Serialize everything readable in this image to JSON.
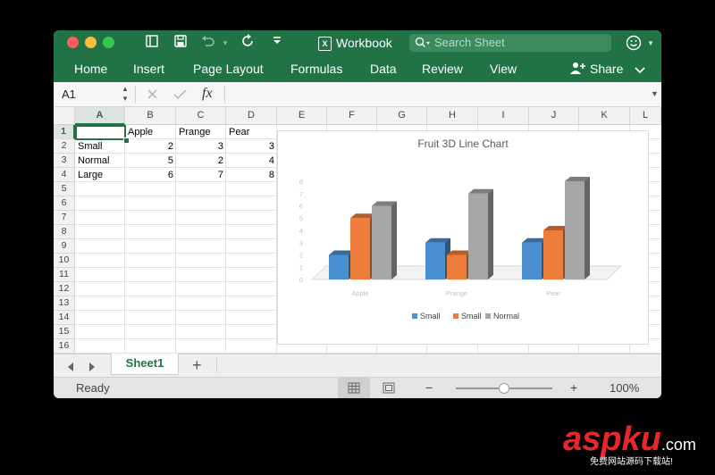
{
  "window": {
    "title": "Workbook"
  },
  "search": {
    "placeholder": "Search Sheet"
  },
  "ribbon": {
    "tabs": [
      "Home",
      "Insert",
      "Page Layout",
      "Formulas",
      "Data",
      "Review",
      "View"
    ],
    "share_label": "Share"
  },
  "formula_bar": {
    "name_box": "A1",
    "fx_label": "fx",
    "formula": ""
  },
  "grid": {
    "columns": [
      "A",
      "B",
      "C",
      "D",
      "E",
      "F",
      "G",
      "H",
      "I",
      "J",
      "K",
      "L"
    ],
    "rows": [
      "1",
      "2",
      "3",
      "4",
      "5",
      "6",
      "7",
      "8",
      "9",
      "10",
      "11",
      "12",
      "13",
      "14",
      "15",
      "16"
    ],
    "cells": {
      "B1": "Apple",
      "C1": "Prange",
      "D1": "Pear",
      "A2": "Small",
      "B2": "2",
      "C2": "3",
      "D2": "3",
      "A3": "Normal",
      "B3": "5",
      "C3": "2",
      "D3": "4",
      "A4": "Large",
      "B4": "6",
      "C4": "7",
      "D4": "8"
    },
    "selected_cell": "A1"
  },
  "chart_data": {
    "type": "bar",
    "title": "Fruit 3D Line Chart",
    "categories": [
      "Apple",
      "Prange",
      "Pear"
    ],
    "series": [
      {
        "name": "Small",
        "values": [
          2,
          3,
          3
        ],
        "color": "#4a8fd0"
      },
      {
        "name": "Small",
        "values": [
          5,
          2,
          4
        ],
        "color": "#ee7d3b"
      },
      {
        "name": "Normal",
        "values": [
          6,
          7,
          8
        ],
        "color": "#a6a6a6"
      }
    ],
    "yticks": [
      "0",
      "1",
      "2",
      "3",
      "4",
      "5",
      "6",
      "7",
      "8"
    ],
    "ylim": [
      0,
      8
    ],
    "legend": "bottom",
    "grid": false
  },
  "sheets": {
    "tabs": [
      "Sheet1"
    ],
    "add_label": "+"
  },
  "status": {
    "text": "Ready",
    "zoom": "100%",
    "zoom_minus": "−",
    "zoom_plus": "+",
    "zoom_level": 0.5
  },
  "watermark": {
    "brand": "aspku",
    "tld": ".com",
    "subtitle": "免费网站源码下载站!"
  },
  "colors": {
    "excel_green": "#217346",
    "selection": "#217346",
    "brand_red": "#e8262b"
  }
}
